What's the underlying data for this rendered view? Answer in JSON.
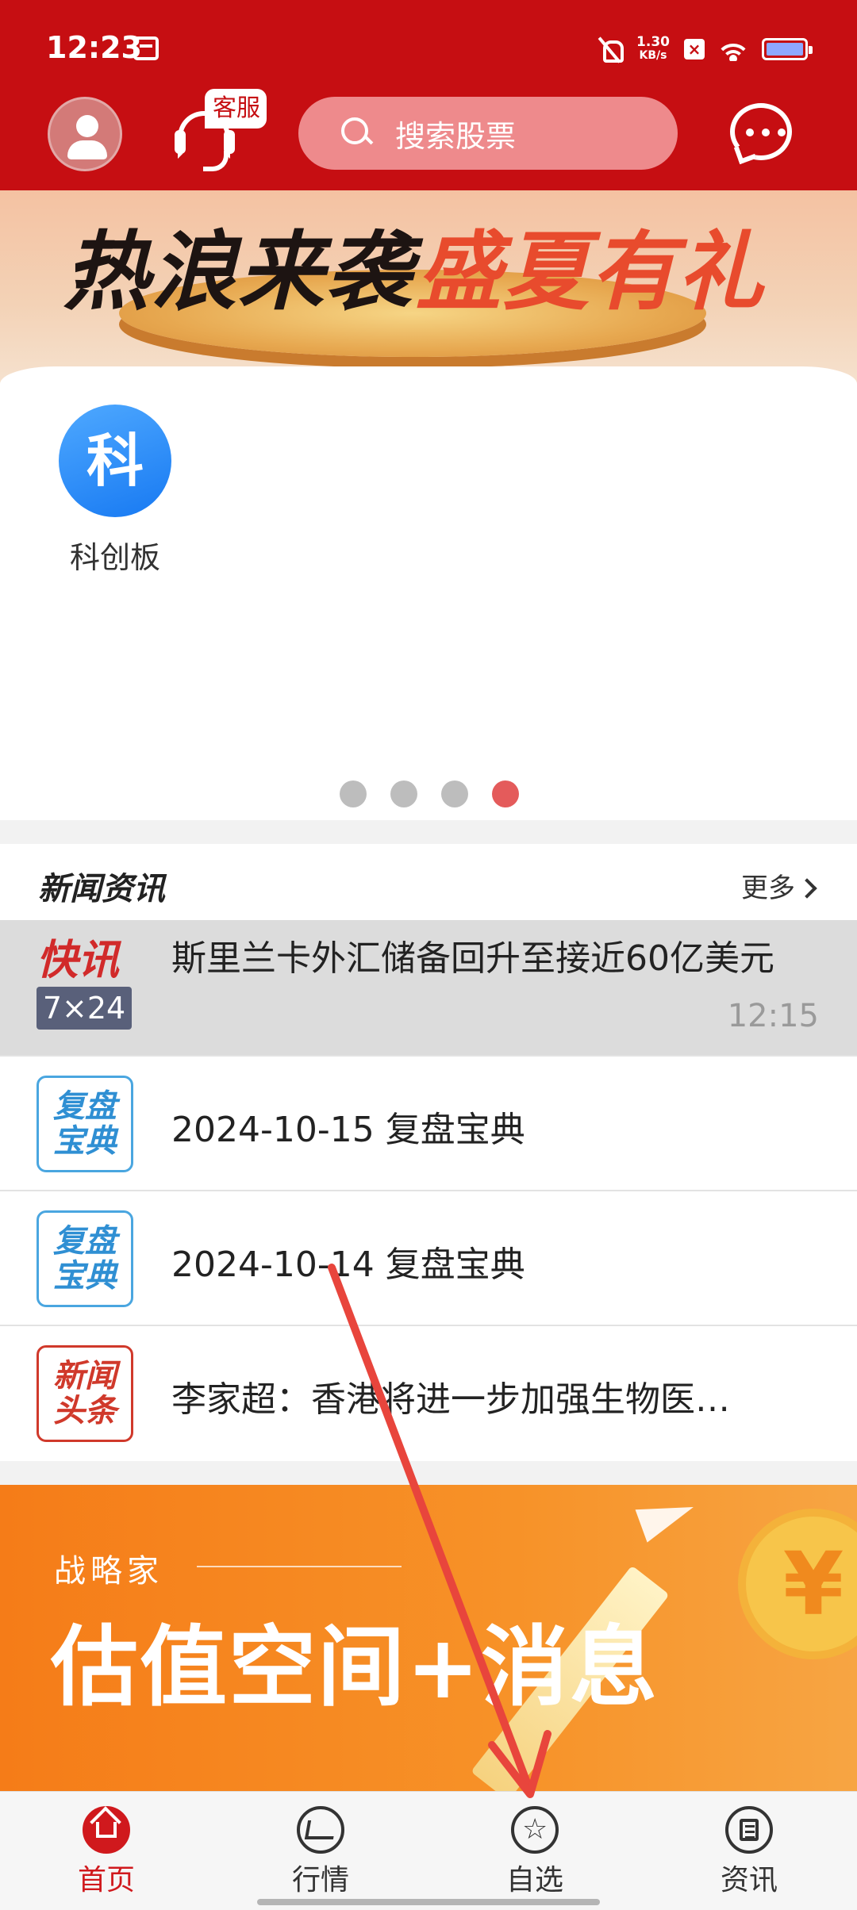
{
  "status_bar": {
    "time": "12:23",
    "net_speed_value": "1.30",
    "net_speed_unit": "KB/s",
    "battery_level": 0.85
  },
  "header": {
    "service_badge": "客服",
    "search_placeholder": "搜索股票",
    "bg_color": "#c60e12"
  },
  "banner": {
    "title_left": "热浪来袭",
    "title_right": "盛夏有礼"
  },
  "quick_entries": [
    {
      "icon_text": "科",
      "label": "科创板",
      "icon": "ke-icon"
    }
  ],
  "carousel": {
    "total": 4,
    "active": 4
  },
  "news": {
    "title": "新闻资讯",
    "more": "更多",
    "items": [
      {
        "tag_top": "快讯",
        "tag_bottom": "7×24",
        "text": "斯里兰卡外汇储备回升至接近60亿美元",
        "time": "12:15"
      },
      {
        "tag_line1": "复盘",
        "tag_line2": "宝典",
        "text": "2024-10-15 复盘宝典"
      },
      {
        "tag_line1": "复盘",
        "tag_line2": "宝典",
        "text": "2024-10-14 复盘宝典"
      },
      {
        "tag_line1": "新闻",
        "tag_line2": "头条",
        "text": "李家超：香港将进一步加强生物医…"
      }
    ]
  },
  "promo": {
    "subtitle": "战略家",
    "title": "估值空间+消息",
    "coin_symbol": "¥"
  },
  "bottom_nav": [
    {
      "label": "首页",
      "icon": "home-icon",
      "active": true
    },
    {
      "label": "行情",
      "icon": "trend-icon",
      "active": false
    },
    {
      "label": "自选",
      "icon": "star-icon",
      "active": false
    },
    {
      "label": "资讯",
      "icon": "news-icon",
      "active": false
    }
  ],
  "annotation_arrow_color": "#e8453c"
}
